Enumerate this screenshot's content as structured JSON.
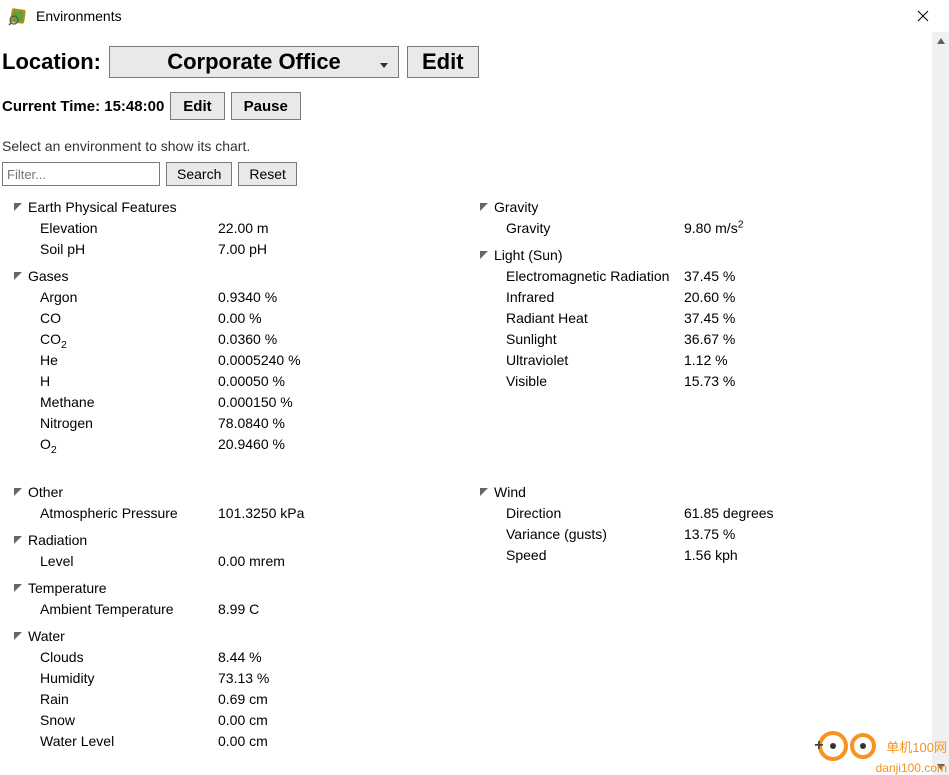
{
  "window": {
    "title": "Environments"
  },
  "location": {
    "label": "Location:",
    "selected": "Corporate Office",
    "edit": "Edit"
  },
  "time": {
    "prefix": "Current Time:",
    "value": "15:48:00",
    "edit": "Edit",
    "pause": "Pause"
  },
  "hint": "Select an environment to show its chart.",
  "filter": {
    "placeholder": "Filter...",
    "search": "Search",
    "reset": "Reset"
  },
  "groups_left": [
    {
      "name": "Earth Physical Features",
      "items": [
        {
          "name": "Elevation",
          "value": "22.00 m"
        },
        {
          "name": "Soil pH",
          "value": "7.00 pH"
        }
      ]
    },
    {
      "name": "Gases",
      "items": [
        {
          "name": "Argon",
          "value": "0.9340 %"
        },
        {
          "name": "CO",
          "value": "0.00 %"
        },
        {
          "name": "CO",
          "sub": "2",
          "value": "0.0360 %"
        },
        {
          "name": "He",
          "value": "0.0005240 %"
        },
        {
          "name": "H",
          "value": "0.00050 %"
        },
        {
          "name": "Methane",
          "value": "0.000150 %"
        },
        {
          "name": "Nitrogen",
          "value": "78.0840 %"
        },
        {
          "name": "O",
          "sub": "2",
          "value": "20.9460 %"
        }
      ]
    }
  ],
  "groups_left2": [
    {
      "name": "Other",
      "items": [
        {
          "name": "Atmospheric Pressure",
          "value": "101.3250 kPa"
        }
      ]
    },
    {
      "name": "Radiation",
      "items": [
        {
          "name": "Level",
          "value": "0.00 mrem"
        }
      ]
    },
    {
      "name": "Temperature",
      "items": [
        {
          "name": "Ambient Temperature",
          "value": "8.99 C"
        }
      ]
    },
    {
      "name": "Water",
      "items": [
        {
          "name": "Clouds",
          "value": "8.44 %"
        },
        {
          "name": "Humidity",
          "value": "73.13 %"
        },
        {
          "name": "Rain",
          "value": "0.69 cm"
        },
        {
          "name": "Snow",
          "value": "0.00 cm"
        },
        {
          "name": "Water Level",
          "value": "0.00 cm"
        }
      ]
    }
  ],
  "groups_right": [
    {
      "name": "Gravity",
      "items": [
        {
          "name": "Gravity",
          "value": "9.80 m/s",
          "sup": "2"
        }
      ]
    },
    {
      "name": "Light (Sun)",
      "items": [
        {
          "name": "Electromagnetic Radiation",
          "value": "37.45 %"
        },
        {
          "name": "Infrared",
          "value": "20.60 %"
        },
        {
          "name": "Radiant Heat",
          "value": "37.45 %"
        },
        {
          "name": "Sunlight",
          "value": "36.67 %"
        },
        {
          "name": "Ultraviolet",
          "value": "1.12 %"
        },
        {
          "name": "Visible",
          "value": "15.73 %"
        }
      ]
    }
  ],
  "groups_right2": [
    {
      "name": "Wind",
      "items": [
        {
          "name": "Direction",
          "value": "61.85 degrees"
        },
        {
          "name": "Variance (gusts)",
          "value": "13.75 %"
        },
        {
          "name": "Speed",
          "value": "1.56 kph"
        }
      ]
    }
  ],
  "watermark": {
    "brand": "单机100网",
    "url": "danji100.com"
  }
}
